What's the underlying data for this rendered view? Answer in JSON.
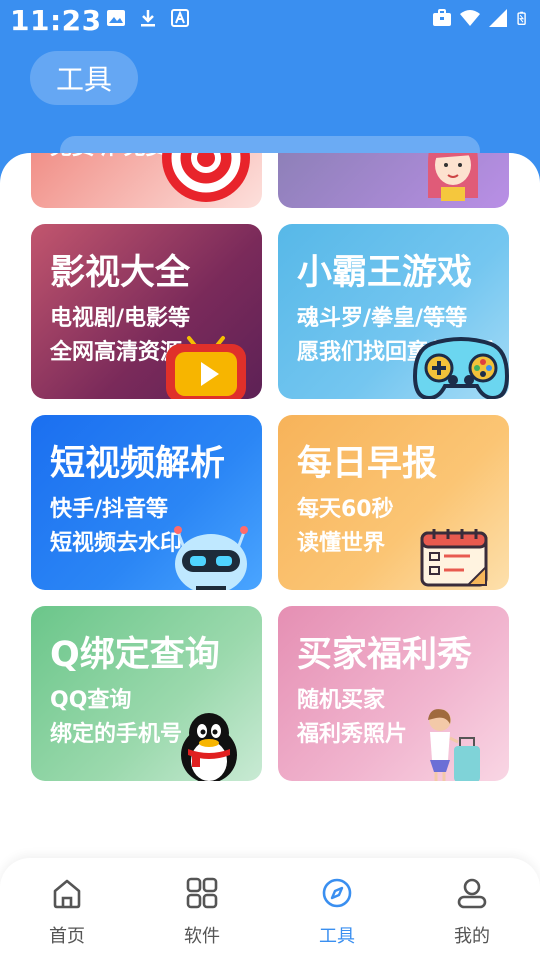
{
  "status_bar": {
    "time": "11:23"
  },
  "header": {
    "tab_label": "工具"
  },
  "cards": [
    {
      "title": "影视大全",
      "line1": "电视剧/电影等",
      "line2": "全网高清资源"
    },
    {
      "title": "小霸王游戏",
      "line1": "魂斗罗/拳皇/等等",
      "line2": "愿我们找回童年快乐"
    },
    {
      "title": "短视频解析",
      "line1": "快手/抖音等",
      "line2": "短视频去水印"
    },
    {
      "title": "每日早报",
      "line1": "每天60秒",
      "line2": "读懂世界"
    },
    {
      "title": "Q绑定查询",
      "line1": "QQ查询",
      "line2": "绑定的手机号"
    },
    {
      "title": "买家福利秀",
      "line1": "随机买家",
      "line2": "福利秀照片"
    }
  ],
  "partial_card": {
    "text": "免费听 免费"
  },
  "bottom_nav": [
    {
      "label": "首页",
      "icon": "home-icon"
    },
    {
      "label": "软件",
      "icon": "grid-icon"
    },
    {
      "label": "工具",
      "icon": "compass-icon",
      "active": true
    },
    {
      "label": "我的",
      "icon": "user-icon"
    }
  ],
  "colors": {
    "primary": "#3a8ff0",
    "nav_inactive": "#555555"
  }
}
